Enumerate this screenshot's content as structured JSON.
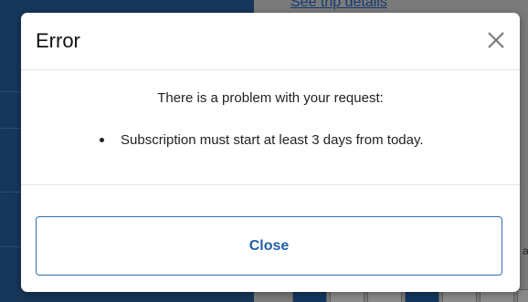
{
  "background": {
    "link_text": "See trip details",
    "side_char": "a"
  },
  "dialog": {
    "title": "Error",
    "close_icon": "close-icon",
    "message": "There is a problem with your request:",
    "errors": [
      "Subscription must start at least 3 days from today."
    ],
    "close_label": "Close"
  },
  "colors": {
    "accent": "#1f5fa6",
    "button_border": "#2f6fb1",
    "background_dark": "#16365a"
  }
}
